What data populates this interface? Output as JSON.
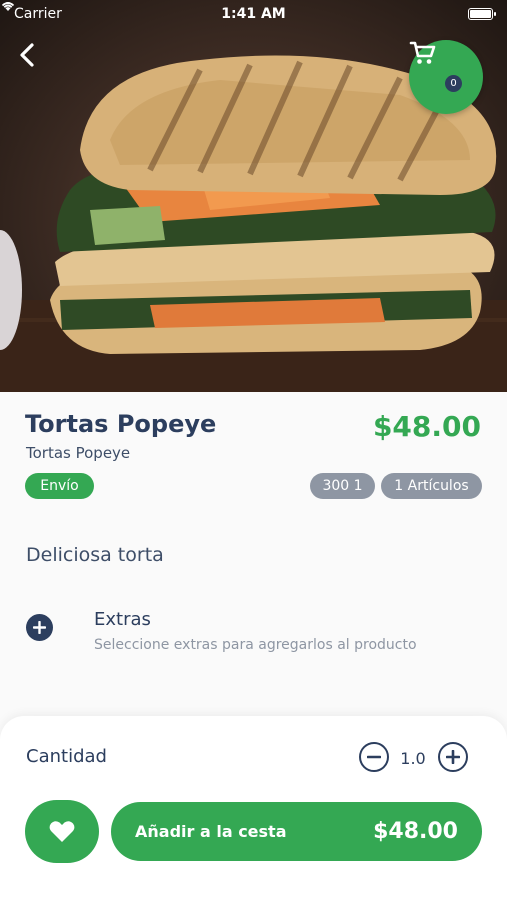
{
  "status_bar": {
    "carrier": "Carrier",
    "time": "1:41 AM"
  },
  "cart": {
    "count": "0"
  },
  "product": {
    "title": "Tortas Popeye",
    "subtitle": "Tortas Popeye",
    "price": "$48.00",
    "badge_shipping": "Envío",
    "badge_code": "300 1",
    "badge_items": "1 Artículos",
    "description": "Deliciosa torta"
  },
  "extras": {
    "title": "Extras",
    "subtitle": "Seleccione extras para agregarlos al producto"
  },
  "quantity": {
    "label": "Cantidad",
    "value": "1.0"
  },
  "add_to_cart": {
    "label": "Añadir a la cesta",
    "price": "$48.00"
  },
  "colors": {
    "accent": "#34a853",
    "text_dark": "#2c3e5e",
    "pill_gray": "#8e96a3"
  },
  "icons": [
    "back-arrow-icon",
    "cart-icon",
    "plus-circle-icon",
    "minus-circle-icon",
    "heart-icon",
    "wifi-icon",
    "battery-icon"
  ]
}
